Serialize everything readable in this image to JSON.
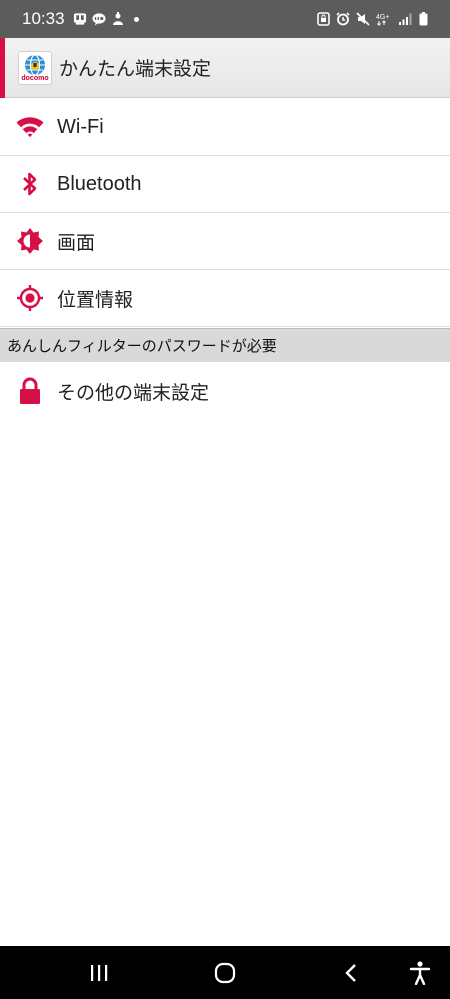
{
  "status_bar": {
    "time": "10:33",
    "network": "4G+"
  },
  "header": {
    "logo_text": "docomo",
    "title": "かんたん端末設定"
  },
  "menu": {
    "items": [
      {
        "label": "Wi-Fi",
        "icon": "wifi-icon"
      },
      {
        "label": "Bluetooth",
        "icon": "bluetooth-icon"
      },
      {
        "label": "画面",
        "icon": "brightness-icon"
      },
      {
        "label": "位置情報",
        "icon": "location-icon"
      }
    ]
  },
  "section": {
    "header": "あんしんフィルターのパスワードが必要"
  },
  "locked_item": {
    "label": "その他の端末設定",
    "icon": "lock-icon"
  },
  "colors": {
    "accent": "#d60f47",
    "status_bar": "#5c5c5c",
    "section_bg": "#d9d9d9",
    "nav_bar": "#000000"
  }
}
